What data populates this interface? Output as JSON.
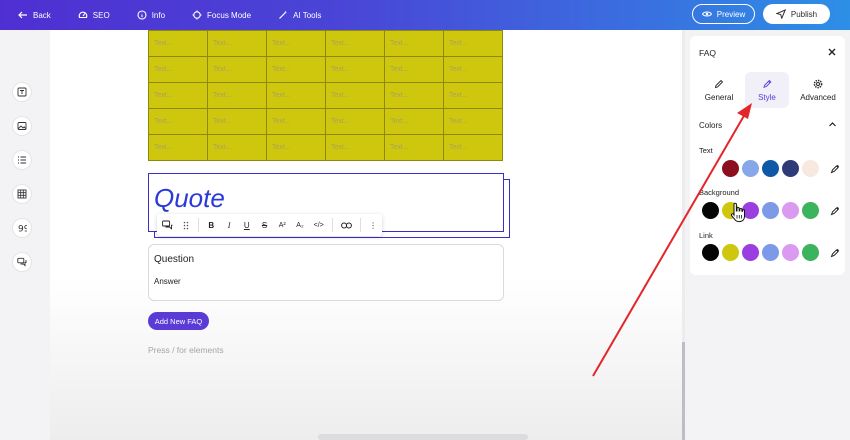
{
  "topbar": {
    "back": "Back",
    "seo": "SEO",
    "info": "Info",
    "focus_mode": "Focus Mode",
    "ai_tools": "AI Tools",
    "preview": "Preview",
    "publish": "Publish"
  },
  "table": {
    "cell_placeholder": "Text...",
    "rows": [
      [
        "Text...",
        "Text...",
        "Text...",
        "Text...",
        "Text...",
        "Text..."
      ],
      [
        "Text...",
        "Text...",
        "Text...",
        "Text...",
        "Text...",
        "Text..."
      ],
      [
        "Text...",
        "Text...",
        "Text...",
        "Text...",
        "Text...",
        "Text..."
      ],
      [
        "Text...",
        "Text...",
        "Text...",
        "Text...",
        "Text...",
        "Text..."
      ],
      [
        "Text...",
        "Text...",
        "Text...",
        "Text...",
        "Text...",
        "Text..."
      ]
    ]
  },
  "quote": {
    "text": "Quote"
  },
  "format_toolbar": {
    "bold": "B",
    "italic": "I",
    "underline": "U",
    "strike": "S",
    "superscript": "A²",
    "subscript": "A₂",
    "code": "</>",
    "more": "⋮"
  },
  "faq": {
    "question": "Question",
    "answer": "Answer",
    "add_button": "Add New FAQ"
  },
  "canvas_hint": "Press / for elements",
  "panel": {
    "title": "FAQ",
    "tabs": [
      {
        "label": "General",
        "icon": "pencil-icon"
      },
      {
        "label": "Style",
        "icon": "brush-icon",
        "active": true
      },
      {
        "label": "Advanced",
        "icon": "gear-icon"
      }
    ],
    "colors": {
      "title": "Colors",
      "text_label": "Text",
      "background_label": "Background",
      "link_label": "Link",
      "text_swatches": [
        "#ffffff",
        "#8b0f1e",
        "#86a7e8",
        "#0f58a8",
        "#2e3b78",
        "#f7e9df"
      ],
      "background_swatches": [
        "#050505",
        "#cfc70e",
        "#9a3ee0",
        "#7d9ae8",
        "#d99af0",
        "#3cb35d"
      ],
      "link_swatches": [
        "#050505",
        "#cfc70e",
        "#9a3ee0",
        "#7d9ae8",
        "#d99af0",
        "#3cb35d"
      ]
    }
  },
  "colors": {
    "accent": "#5b3bd6",
    "quote_text": "#2a3ad9",
    "annotation_arrow": "#e3262a",
    "table_bg": "#cfc70e"
  }
}
